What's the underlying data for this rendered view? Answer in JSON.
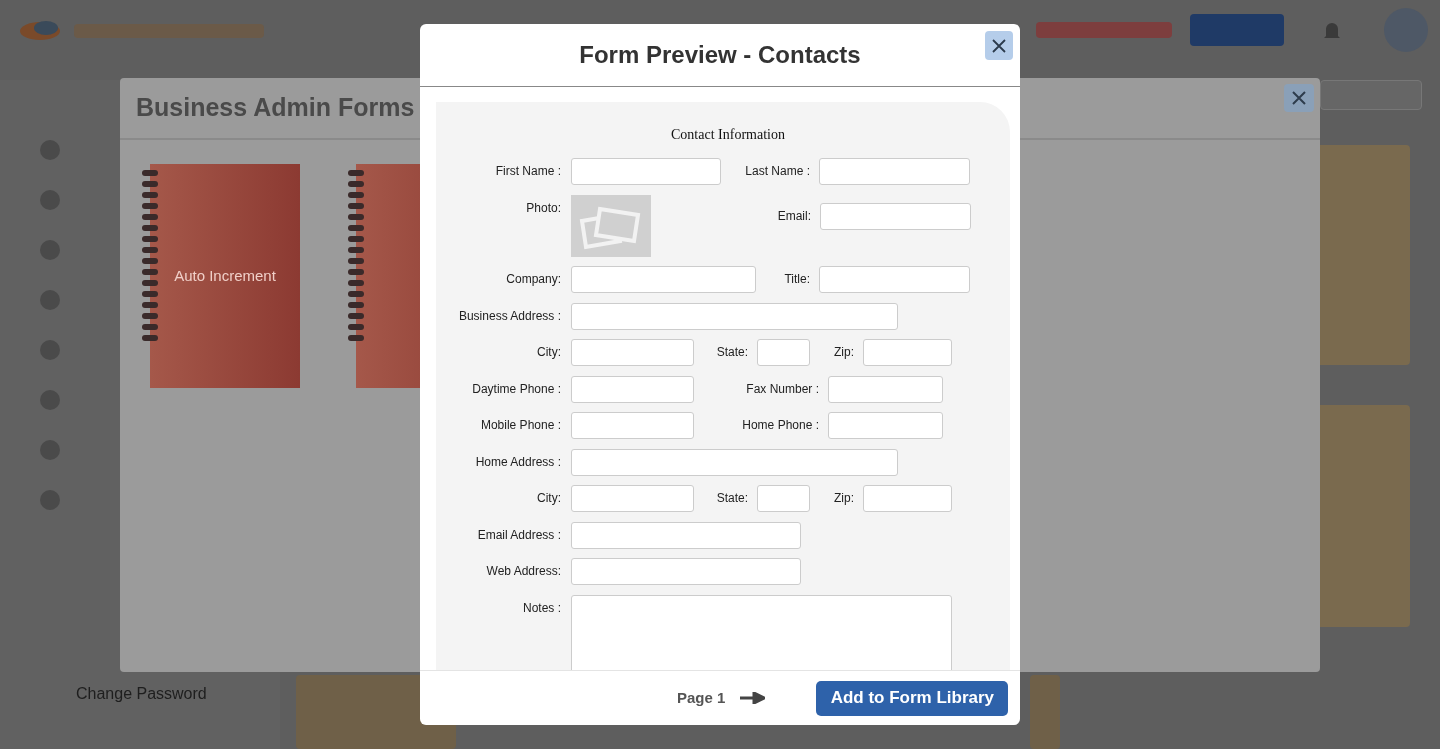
{
  "background": {
    "dialog_title": "Business Admin Forms",
    "notebooks": [
      {
        "kind": "notebook",
        "label": "Auto Increment"
      },
      {
        "kind": "notebook"
      }
    ],
    "sidebar_items": [
      {
        "label": "Change Password"
      }
    ]
  },
  "preview": {
    "title": "Form Preview - Contacts",
    "section_title": "Contact Information",
    "rows": [
      {
        "fields": [
          {
            "label": "First Name :",
            "kind": "input"
          },
          {
            "label": "Last Name :",
            "kind": "input"
          }
        ]
      },
      {
        "fields": [
          {
            "label": "Photo:",
            "kind": "photo"
          },
          {
            "label": "Email:",
            "kind": "input"
          }
        ]
      },
      {
        "fields": [
          {
            "label": "Company:",
            "kind": "input"
          },
          {
            "label": "Title:",
            "kind": "input"
          }
        ]
      },
      {
        "fields": [
          {
            "label": "Business Address :",
            "kind": "input"
          }
        ]
      },
      {
        "fields": [
          {
            "label": "City:",
            "kind": "input"
          },
          {
            "label": "State:",
            "kind": "input"
          },
          {
            "label": "Zip:",
            "kind": "input"
          }
        ]
      },
      {
        "fields": [
          {
            "label": "Daytime Phone :",
            "kind": "input"
          },
          {
            "label": "Fax Number :",
            "kind": "input"
          }
        ]
      },
      {
        "fields": [
          {
            "label": "Mobile Phone :",
            "kind": "input"
          },
          {
            "label": "Home Phone :",
            "kind": "input"
          }
        ]
      },
      {
        "fields": [
          {
            "label": "Home Address :",
            "kind": "input"
          }
        ]
      },
      {
        "fields": [
          {
            "label": "City:",
            "kind": "input"
          },
          {
            "label": "State:",
            "kind": "input"
          },
          {
            "label": "Zip:",
            "kind": "input"
          }
        ]
      },
      {
        "fields": [
          {
            "label": "Email Address :",
            "kind": "input"
          }
        ]
      },
      {
        "fields": [
          {
            "label": "Web Address:",
            "kind": "input"
          }
        ]
      },
      {
        "fields": [
          {
            "label": "Notes :",
            "kind": "textarea"
          }
        ]
      }
    ],
    "page_label": "Page 1",
    "add_button": "Add to Form Library"
  }
}
